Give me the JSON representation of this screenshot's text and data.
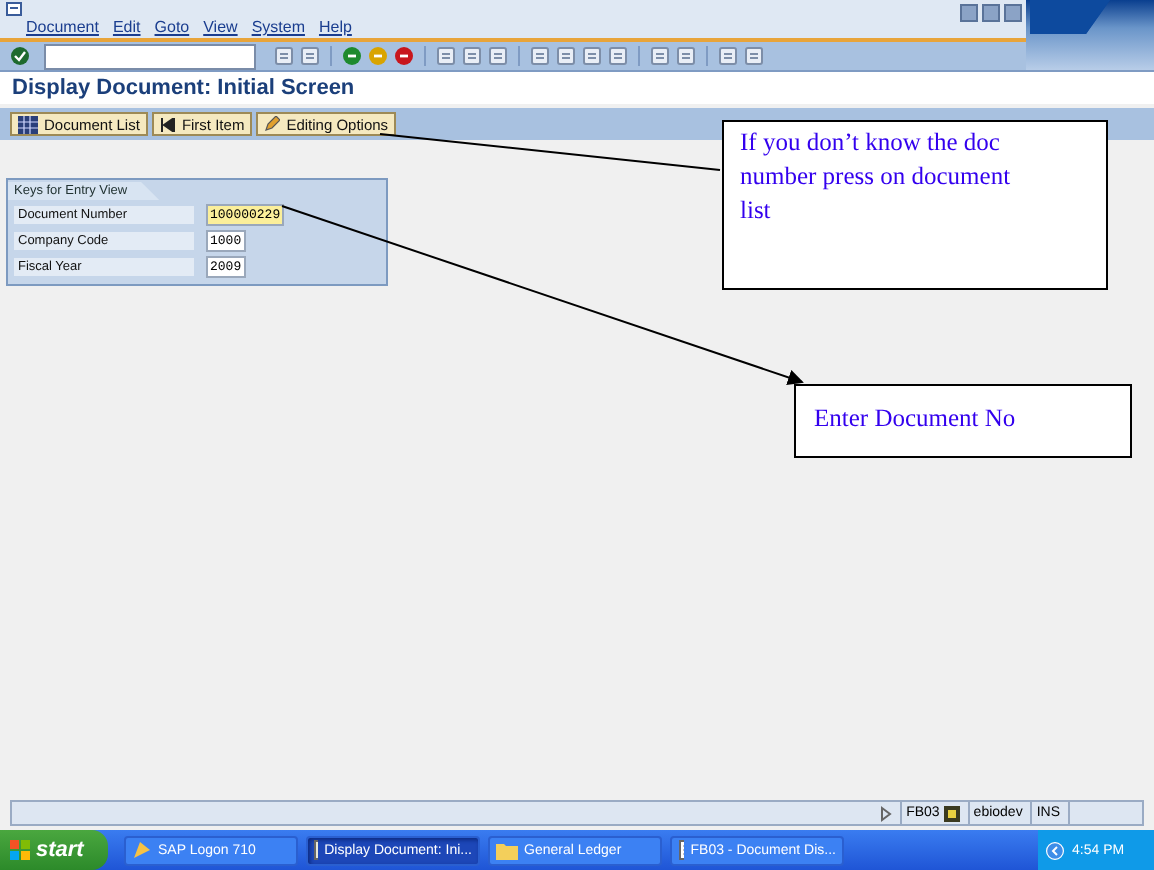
{
  "window": {
    "menu": [
      "Document",
      "Edit",
      "Goto",
      "View",
      "System",
      "Help"
    ],
    "title": "Display Document: Initial Screen"
  },
  "app_toolbar": [
    {
      "label": "Document List"
    },
    {
      "label": "First Item"
    },
    {
      "label": "Editing Options"
    }
  ],
  "form": {
    "title": "Keys for Entry View",
    "fields": [
      {
        "label": "Document Number",
        "value": "100000229",
        "focused": true
      },
      {
        "label": "Company Code",
        "value": "1000",
        "focused": false
      },
      {
        "label": "Fiscal Year",
        "value": "2009",
        "focused": false
      }
    ]
  },
  "status_bar": {
    "transaction": "FB03",
    "server": "ebiodev",
    "mode": "INS"
  },
  "taskbar": {
    "start": "start",
    "items": [
      {
        "label": "SAP Logon 710",
        "selected": false
      },
      {
        "label": "Display Document: Ini...",
        "selected": true
      },
      {
        "label": "General Ledger",
        "selected": false
      },
      {
        "label": "FB03 - Document Dis...",
        "selected": false
      }
    ],
    "clock": "4:54 PM"
  },
  "callouts": [
    {
      "text": "If you don’t know the doc number press on document list"
    },
    {
      "text": "Enter Document No"
    }
  ]
}
